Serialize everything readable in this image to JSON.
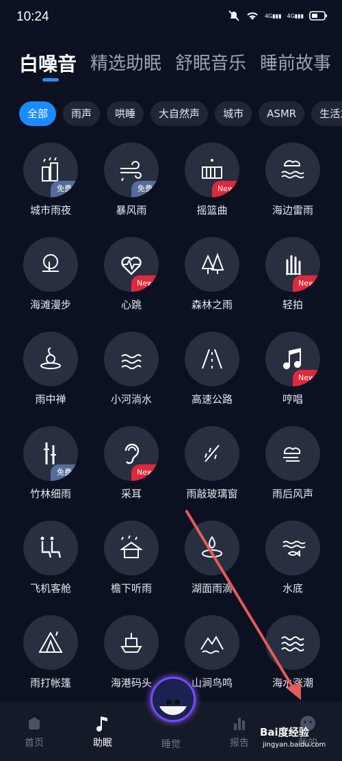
{
  "status": {
    "time": "10:24",
    "net1": "4G",
    "net2": "4G"
  },
  "tabs": [
    "白噪音",
    "精选助眠",
    "舒眠音乐",
    "睡前故事"
  ],
  "chips": [
    "全部",
    "雨声",
    "哄睡",
    "大自然声",
    "城市",
    "ASMR",
    "生活之"
  ],
  "sounds": [
    {
      "label": "城市雨夜",
      "badge": "免费",
      "icon": "city-rain-icon"
    },
    {
      "label": "暴风雨",
      "badge": "免费",
      "icon": "storm-wind-icon"
    },
    {
      "label": "摇篮曲",
      "badge": "New",
      "icon": "crib-icon"
    },
    {
      "label": "海边雷雨",
      "badge": "",
      "icon": "sea-thunder-icon"
    },
    {
      "label": "海滩漫步",
      "badge": "",
      "icon": "beach-icon"
    },
    {
      "label": "心跳",
      "badge": "New",
      "icon": "heartbeat-icon"
    },
    {
      "label": "森林之雨",
      "badge": "",
      "icon": "forest-rain-icon"
    },
    {
      "label": "轻拍",
      "badge": "New",
      "icon": "hand-pat-icon"
    },
    {
      "label": "雨中禅",
      "badge": "",
      "icon": "zen-icon"
    },
    {
      "label": "小河淌水",
      "badge": "",
      "icon": "river-icon"
    },
    {
      "label": "高速公路",
      "badge": "",
      "icon": "highway-icon"
    },
    {
      "label": "哼唱",
      "badge": "New",
      "icon": "music-note-icon"
    },
    {
      "label": "竹林细雨",
      "badge": "免费",
      "icon": "bamboo-icon"
    },
    {
      "label": "采耳",
      "badge": "New",
      "icon": "ear-icon"
    },
    {
      "label": "雨敲玻璃窗",
      "badge": "",
      "icon": "window-rain-icon"
    },
    {
      "label": "雨后风声",
      "badge": "",
      "icon": "cloud-wind-icon"
    },
    {
      "label": "飞机客舱",
      "badge": "",
      "icon": "airplane-seat-icon"
    },
    {
      "label": "檐下听雨",
      "badge": "",
      "icon": "house-rain-icon"
    },
    {
      "label": "湖面雨滴",
      "badge": "",
      "icon": "lake-drop-icon"
    },
    {
      "label": "水底",
      "badge": "",
      "icon": "underwater-icon"
    },
    {
      "label": "雨打帐篷",
      "badge": "",
      "icon": "tent-icon"
    },
    {
      "label": "海港码头",
      "badge": "",
      "icon": "ship-icon"
    },
    {
      "label": "山涧鸟鸣",
      "badge": "",
      "icon": "mountain-icon"
    },
    {
      "label": "海水涨潮",
      "badge": "",
      "icon": "waves-icon"
    }
  ],
  "nav": [
    {
      "label": "首页",
      "icon": "home-icon"
    },
    {
      "label": "助眠",
      "icon": "music-icon"
    },
    {
      "label": "睡觉",
      "icon": "sleep-icon"
    },
    {
      "label": "报告",
      "icon": "report-icon"
    },
    {
      "label": "我的",
      "icon": "profile-icon"
    }
  ],
  "watermark": {
    "main": "Bai度经验",
    "sub": "jingyan.baidu.com"
  },
  "colors": {
    "accent": "#1a8cff",
    "new_badge": "#e0283c",
    "free_badge": "#566c9a",
    "annotation_arrow": "#e85a5a"
  }
}
